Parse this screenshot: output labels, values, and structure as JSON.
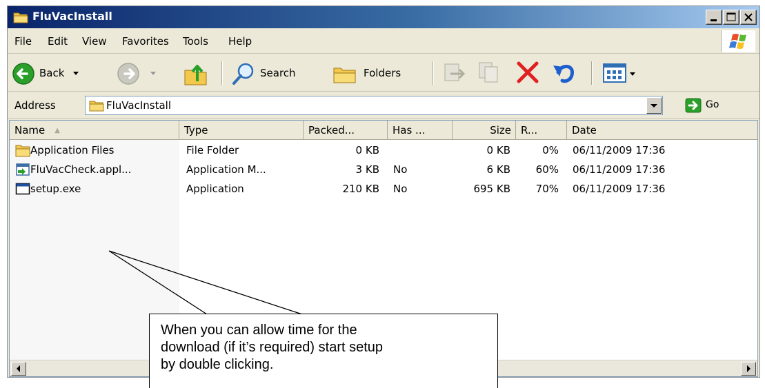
{
  "window": {
    "title": "FluVacInstall"
  },
  "menu": [
    "File",
    "Edit",
    "View",
    "Favorites",
    "Tools",
    "Help"
  ],
  "toolbar": {
    "back": "Back",
    "search": "Search",
    "folders": "Folders"
  },
  "address": {
    "label": "Address",
    "value": "FluVacInstall",
    "go": "Go"
  },
  "columns": [
    "Name",
    "Type",
    "Packed...",
    "Has ...",
    "Size",
    "R...",
    "Date"
  ],
  "files": [
    {
      "icon": "folder-icon",
      "name": "Application Files",
      "type": "File Folder",
      "packed": "0 KB",
      "has": "",
      "size": "0 KB",
      "ratio": "0%",
      "date": "06/11/2009 17:36"
    },
    {
      "icon": "application-manifest-icon",
      "name": "FluVacCheck.appl...",
      "type": "Application M...",
      "packed": "3 KB",
      "has": "No",
      "size": "6 KB",
      "ratio": "60%",
      "date": "06/11/2009 17:36"
    },
    {
      "icon": "application-icon",
      "name": "setup.exe",
      "type": "Application",
      "packed": "210 KB",
      "has": "No",
      "size": "695 KB",
      "ratio": "70%",
      "date": "06/11/2009 17:36"
    }
  ],
  "callout": {
    "lines": [
      "When you can allow time for the",
      "download (if it’s required) start setup",
      "by double clicking."
    ]
  },
  "colors": {
    "titlebar_start": "#0a246a",
    "titlebar_end": "#a6caf0",
    "chrome": "#ece9d8",
    "delete_red": "#e02020",
    "back_green": "#2aa02a"
  }
}
